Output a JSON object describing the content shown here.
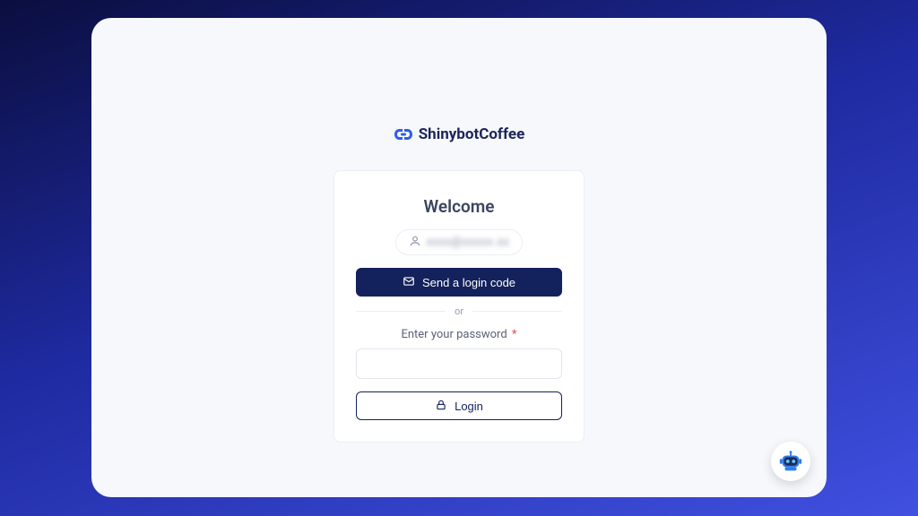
{
  "brand": {
    "name": "ShinybotCoffee"
  },
  "login": {
    "welcome": "Welcome",
    "email_masked": "xxxx@xxxxx.xx",
    "send_code_label": "Send a login code",
    "divider_label": "or",
    "password_label": "Enter your password",
    "password_required_marker": "*",
    "password_value": "",
    "login_button_label": "Login"
  },
  "icons": {
    "logo": "link-loop-icon",
    "user": "user-icon",
    "mail": "mail-icon",
    "lock": "lock-icon",
    "chatbot": "robot-icon"
  }
}
